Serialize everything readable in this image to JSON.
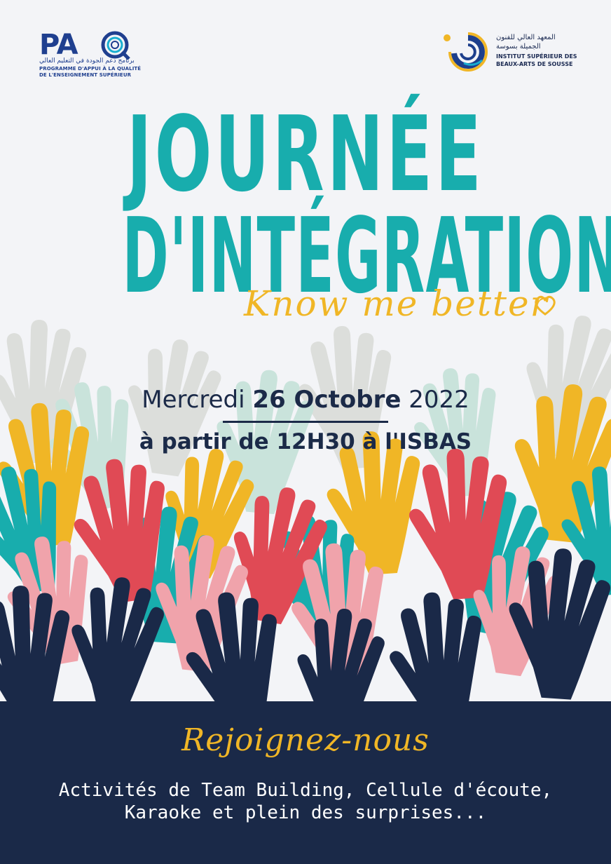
{
  "logos": {
    "pao": {
      "mark": "PA",
      "arabic": "برنامج دعم الجودة في التعليم العالي",
      "line1": "PROGRAMME D'APPUI À LA QUALITÉ",
      "line2": "DE L'ENSEIGNEMENT SUPÉRIEUR"
    },
    "isbas": {
      "arabic1": "المعهد العالي للفنون",
      "arabic2": "الجميلة بسوسة",
      "line1": "INSTITUT SUPÉRIEUR DES",
      "line2": "BEAUX-ARTS DE SOUSSE"
    }
  },
  "title": {
    "line1": "JOURNÉE",
    "line2": "D'INTÉGRATION"
  },
  "tagline": "Know me better",
  "event": {
    "day": "Mercredi",
    "date": "26 Octobre",
    "year": "2022",
    "time_place": "à partir de 12H30 à l'ISBAS"
  },
  "invite": {
    "heading": "Rejoignez-nous",
    "line1": "Activités de Team Building, Cellule d'écoute,",
    "line2": "Karaoke et plein des surprises..."
  },
  "colors": {
    "teal": "#18adad",
    "yellow": "#f0b626",
    "red": "#e04a55",
    "pink": "#f0a3ab",
    "navy": "#1a2948",
    "pale_gray": "#dcdedb",
    "pale_mint": "#c9e3db"
  },
  "icons": [
    "pao-logo-icon",
    "isbas-logo-icon",
    "heart-icon",
    "raised-hands-illustration"
  ]
}
